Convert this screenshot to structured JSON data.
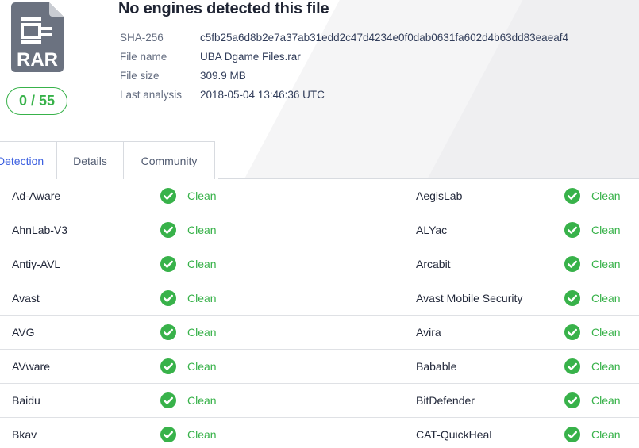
{
  "file": {
    "type_label": "RAR",
    "icon": "rar-file-icon",
    "score": "0 / 55",
    "title": "No engines detected this file"
  },
  "meta": [
    {
      "key": "SHA-256",
      "value": "c5fb25a6d8b2e7a37ab31edd2c47d4234e0f0dab0631fa602d4b63dd83eaeaf4"
    },
    {
      "key": "File name",
      "value": "UBA Dgame Files.rar"
    },
    {
      "key": "File size",
      "value": "309.9 MB"
    },
    {
      "key": "Last analysis",
      "value": "2018-05-04 13:46:36 UTC"
    }
  ],
  "tabs": [
    {
      "label": "Detection",
      "active": true
    },
    {
      "label": "Details",
      "active": false
    },
    {
      "label": "Community",
      "active": false
    }
  ],
  "colors": {
    "clean": "#38b24a",
    "active_tab": "#3b5fe0"
  },
  "rows": [
    {
      "left": {
        "engine": "Ad-Aware",
        "status": "Clean"
      },
      "right": {
        "engine": "AegisLab",
        "status": "Clean"
      }
    },
    {
      "left": {
        "engine": "AhnLab-V3",
        "status": "Clean"
      },
      "right": {
        "engine": "ALYac",
        "status": "Clean"
      }
    },
    {
      "left": {
        "engine": "Antiy-AVL",
        "status": "Clean"
      },
      "right": {
        "engine": "Arcabit",
        "status": "Clean"
      }
    },
    {
      "left": {
        "engine": "Avast",
        "status": "Clean"
      },
      "right": {
        "engine": "Avast Mobile Security",
        "status": "Clean"
      }
    },
    {
      "left": {
        "engine": "AVG",
        "status": "Clean"
      },
      "right": {
        "engine": "Avira",
        "status": "Clean"
      }
    },
    {
      "left": {
        "engine": "AVware",
        "status": "Clean"
      },
      "right": {
        "engine": "Babable",
        "status": "Clean"
      }
    },
    {
      "left": {
        "engine": "Baidu",
        "status": "Clean"
      },
      "right": {
        "engine": "BitDefender",
        "status": "Clean"
      }
    },
    {
      "left": {
        "engine": "Bkav",
        "status": "Clean"
      },
      "right": {
        "engine": "CAT-QuickHeal",
        "status": "Clean"
      }
    }
  ]
}
